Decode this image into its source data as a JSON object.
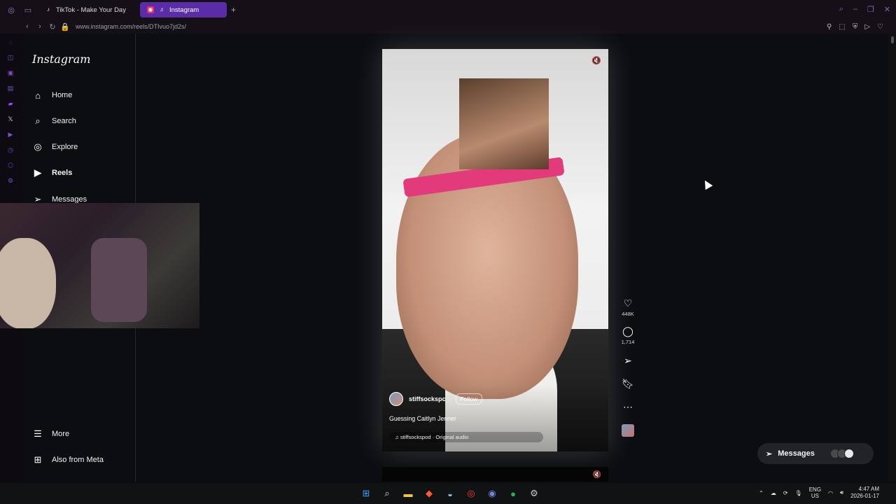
{
  "browser": {
    "tabs": [
      {
        "label": "TikTok - Make Your Day",
        "icon": "tiktok-icon"
      },
      {
        "label": "Instagram",
        "icon": "instagram-icon"
      }
    ],
    "url": "www.instagram.com/reels/DTIvuo7jd2s/"
  },
  "instagram": {
    "logo": "Instagram",
    "nav": [
      {
        "label": "Home",
        "icon": "home-icon"
      },
      {
        "label": "Search",
        "icon": "search-icon"
      },
      {
        "label": "Explore",
        "icon": "compass-icon"
      },
      {
        "label": "Reels",
        "icon": "reels-icon"
      },
      {
        "label": "Messages",
        "icon": "send-icon"
      }
    ],
    "bottom_nav": [
      {
        "label": "More",
        "icon": "menu-icon"
      },
      {
        "label": "Also from Meta",
        "icon": "meta-grid-icon"
      }
    ]
  },
  "reel": {
    "username": "stiffsockspc",
    "follow_label": "Follow",
    "caption": "Guessing Caitlyn Jenner",
    "audio": "stiffsockspod · Original audio",
    "likes": "448K",
    "comments": "1,714"
  },
  "messages_pill": {
    "label": "Messages"
  },
  "taskbar": {
    "lang_top": "ENG",
    "lang_bottom": "US",
    "time": "4:47 AM",
    "date": "2026-01-17"
  }
}
